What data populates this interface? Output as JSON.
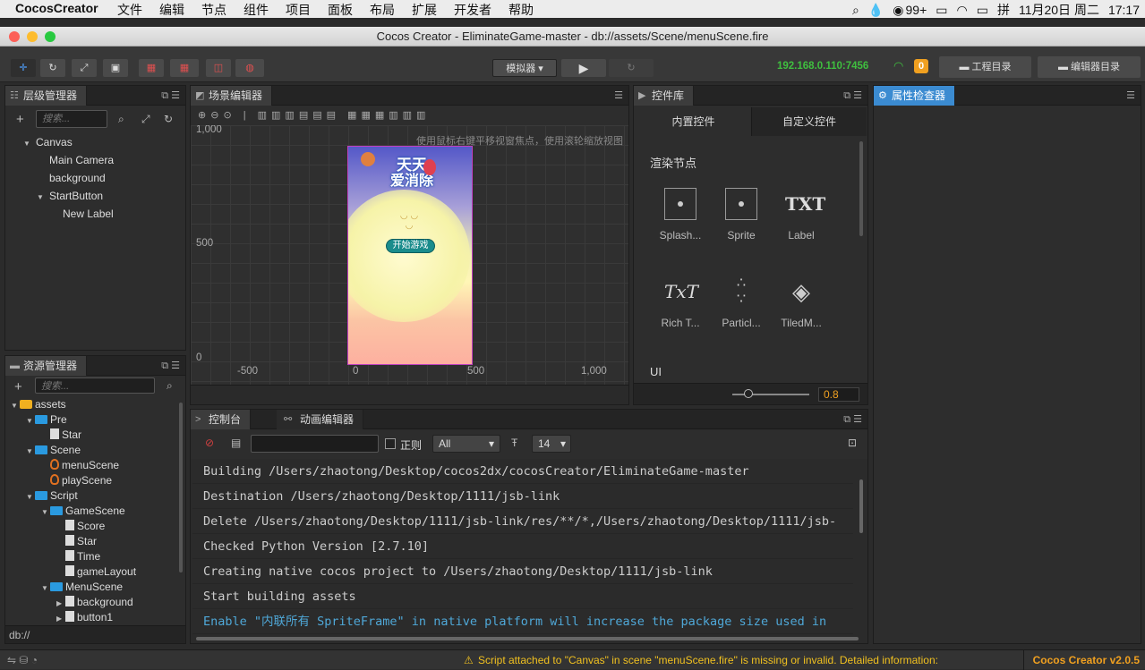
{
  "menubar": {
    "app": "CocosCreator",
    "items": [
      "文件",
      "编辑",
      "节点",
      "组件",
      "项目",
      "面板",
      "布局",
      "扩展",
      "开发者",
      "帮助"
    ],
    "tray": {
      "badge": "99+",
      "datetime": "11月20日 周二",
      "time": "17:17"
    }
  },
  "window": {
    "title": "Cocos Creator - EliminateGame-master - db://assets/Scene/menuScene.fire"
  },
  "toolbar": {
    "simulator_label": "模拟器",
    "ip": "192.168.0.110:7456",
    "wifi_count": "0",
    "project_dir_label": "工程目录",
    "editor_dir_label": "编辑器目录"
  },
  "hierarchy": {
    "title": "层级管理器",
    "search_placeholder": "搜索...",
    "nodes": [
      {
        "label": "Canvas",
        "indent": 0,
        "arrow": "▼"
      },
      {
        "label": "Main Camera",
        "indent": 1,
        "arrow": ""
      },
      {
        "label": "background",
        "indent": 1,
        "arrow": ""
      },
      {
        "label": "StartButton",
        "indent": 1,
        "arrow": "▼"
      },
      {
        "label": "New Label",
        "indent": 2,
        "arrow": ""
      }
    ]
  },
  "assets": {
    "title": "资源管理器",
    "search_placeholder": "搜索...",
    "footer": "db://",
    "items": [
      {
        "label": "assets",
        "indent": 0
      },
      {
        "label": "Pre",
        "indent": 1
      },
      {
        "label": "Star",
        "indent": 2
      },
      {
        "label": "Scene",
        "indent": 1
      },
      {
        "label": "menuScene",
        "indent": 2
      },
      {
        "label": "playScene",
        "indent": 2
      },
      {
        "label": "Script",
        "indent": 1
      },
      {
        "label": "GameScene",
        "indent": 2
      },
      {
        "label": "Score",
        "indent": 3
      },
      {
        "label": "Star",
        "indent": 3
      },
      {
        "label": "Time",
        "indent": 3
      },
      {
        "label": "gameLayout",
        "indent": 3
      },
      {
        "label": "MenuScene",
        "indent": 2
      },
      {
        "label": "background",
        "indent": 3
      },
      {
        "label": "button1",
        "indent": 3
      }
    ]
  },
  "scene": {
    "title": "场景编辑器",
    "hint": "使用鼠标右键平移视窗焦点，使用滚轮缩放视图",
    "y_labels": [
      "1,000",
      "500",
      "0"
    ],
    "x_labels": [
      "-500",
      "0",
      "500",
      "1,000"
    ],
    "game_title_1": "天天",
    "game_title_2": "爱消除",
    "start_button": "开始游戏"
  },
  "widgets": {
    "title": "控件库",
    "tab_builtin": "内置控件",
    "tab_custom": "自定义控件",
    "section_render": "渲染节点",
    "section_ui": "UI",
    "items": [
      {
        "label": "Splash...",
        "glyph": ""
      },
      {
        "label": "Sprite",
        "glyph": ""
      },
      {
        "label": "Label",
        "glyph": "TXT"
      },
      {
        "label": "Rich T...",
        "glyph": "TxT"
      },
      {
        "label": "Particl...",
        "glyph": ""
      },
      {
        "label": "TiledM...",
        "glyph": ""
      }
    ],
    "zoom": "0.8"
  },
  "inspector": {
    "title": "属性检查器"
  },
  "console": {
    "title": "控制台",
    "anim_title": "动画编辑器",
    "regex_label": "正则",
    "filter_value": "All",
    "font_size": "14",
    "logs": [
      {
        "text": "Building /Users/zhaotong/Desktop/cocos2dx/cocosCreator/EliminateGame-master",
        "color": "#cccccc"
      },
      {
        "text": "Destination /Users/zhaotong/Desktop/1111/jsb-link",
        "color": "#cccccc"
      },
      {
        "text": "Delete /Users/zhaotong/Desktop/1111/jsb-link/res/**/*,/Users/zhaotong/Desktop/1111/jsb-",
        "color": "#cccccc"
      },
      {
        "text": "Checked Python Version [2.7.10]",
        "color": "#cccccc"
      },
      {
        "text": "Creating native cocos project to /Users/zhaotong/Desktop/1111/jsb-link",
        "color": "#cccccc"
      },
      {
        "text": "Start building assets",
        "color": "#cccccc"
      },
      {
        "text": "Enable \"内联所有 SpriteFrame\" in native platform will increase the package size used in",
        "color": "#4fa8d8"
      }
    ]
  },
  "status": {
    "warning": "Script attached to \"Canvas\" in scene \"menuScene.fire\" is missing or invalid. Detailed information:",
    "version": "Cocos Creator v2.0.5"
  },
  "colors": {
    "accent": "#3b8bd1",
    "ip_green": "#3fbf3f",
    "orange": "#f0a020"
  }
}
